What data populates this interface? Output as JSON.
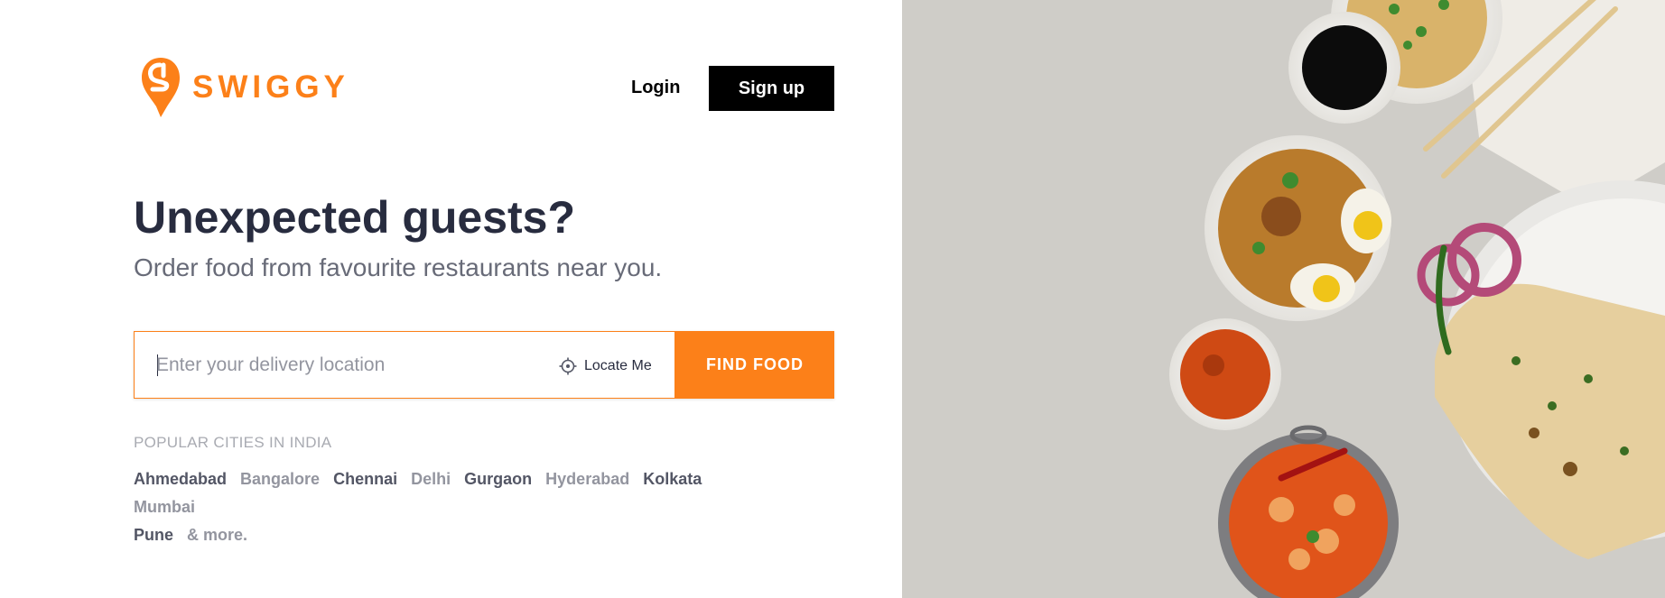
{
  "brand": {
    "name": "SWIGGY",
    "color": "#fc8019"
  },
  "header": {
    "login_label": "Login",
    "signup_label": "Sign up"
  },
  "hero": {
    "headline": "Unexpected guests?",
    "subheadline": "Order food from favourite restaurants near you."
  },
  "search": {
    "placeholder": "Enter your delivery location",
    "value": "",
    "locate_label": "Locate Me",
    "locate_icon": "crosshair-icon",
    "button_label": "FIND FOOD"
  },
  "popular": {
    "title": "POPULAR CITIES IN INDIA",
    "cities": [
      "Ahmedabad",
      "Bangalore",
      "Chennai",
      "Delhi",
      "Gurgaon",
      "Hyderabad",
      "Kolkata",
      "Mumbai",
      "Pune"
    ],
    "more_label": "& more."
  },
  "hero_image": {
    "description_icon": "food-platter-image"
  }
}
